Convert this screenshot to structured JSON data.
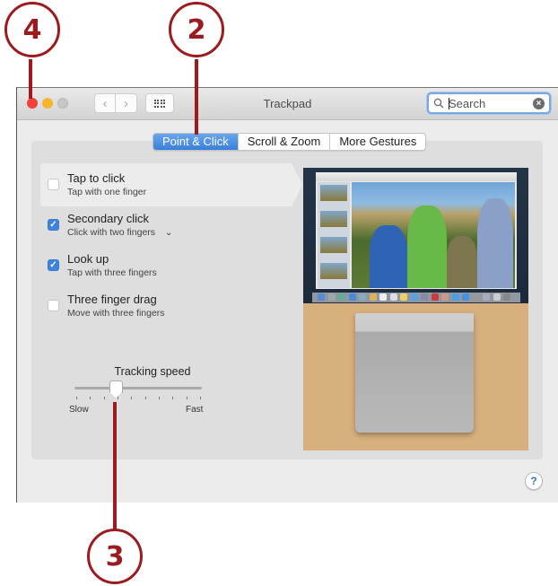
{
  "callouts": [
    {
      "number": "4",
      "target": "close-window-button"
    },
    {
      "number": "2",
      "target": "tab-point-and-click"
    },
    {
      "number": "3",
      "target": "tracking-speed-slider"
    }
  ],
  "window": {
    "title": "Trackpad",
    "traffic_lights": {
      "close_color": "#f2403a",
      "minimize_color": "#f7b52c",
      "zoom_color": "#c7c7c7"
    },
    "nav": {
      "back_glyph": "‹",
      "forward_glyph": "›",
      "show_all_icon": "grid-icon"
    }
  },
  "search": {
    "placeholder": "Search",
    "value": "",
    "clear_glyph": "×"
  },
  "tabs": [
    {
      "label": "Point & Click",
      "active": true
    },
    {
      "label": "Scroll & Zoom",
      "active": false
    },
    {
      "label": "More Gestures",
      "active": false
    }
  ],
  "options": [
    {
      "title": "Tap to click",
      "subtitle": "Tap with one finger",
      "checked": false,
      "selected": true,
      "has_dropdown": false
    },
    {
      "title": "Secondary click",
      "subtitle": "Click with two fingers",
      "checked": true,
      "selected": false,
      "has_dropdown": true
    },
    {
      "title": "Look up",
      "subtitle": "Tap with three fingers",
      "checked": true,
      "selected": false,
      "has_dropdown": false
    },
    {
      "title": "Three finger drag",
      "subtitle": "Move with three fingers",
      "checked": false,
      "selected": false,
      "has_dropdown": false
    }
  ],
  "tracking_speed": {
    "label": "Tracking speed",
    "min_label": "Slow",
    "max_label": "Fast",
    "tick_count": 10,
    "value_fraction": 0.33
  },
  "check_glyph": "✓",
  "dropdown_glyph": "⌄",
  "help": {
    "glyph": "?"
  },
  "accent_color": "#3e84de"
}
